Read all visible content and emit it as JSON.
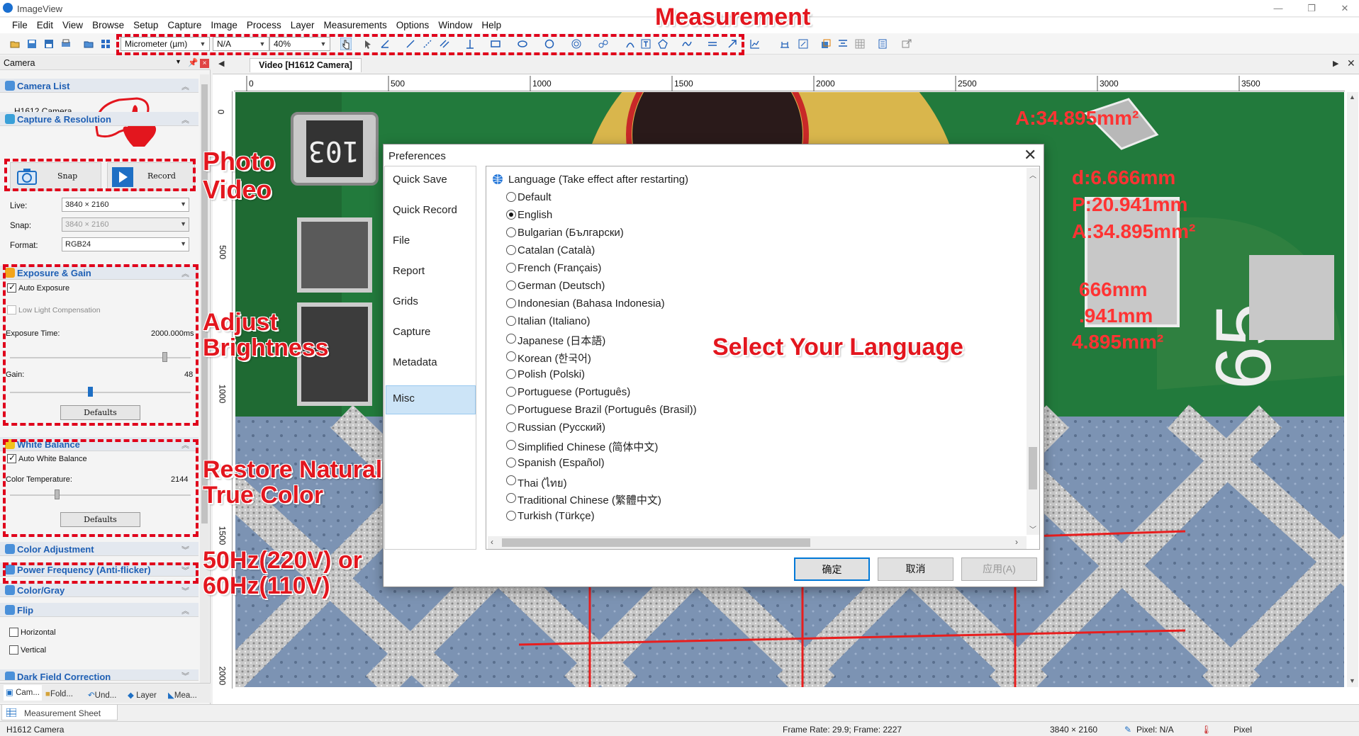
{
  "window": {
    "title": "ImageView"
  },
  "menu": [
    "File",
    "Edit",
    "View",
    "Browse",
    "Setup",
    "Capture",
    "Image",
    "Process",
    "Layer",
    "Measurements",
    "Options",
    "Window",
    "Help"
  ],
  "toolbar": {
    "unit": "Micrometer (µm)",
    "calibration": "N/A",
    "zoom": "40%"
  },
  "panel": {
    "title": "Camera",
    "camera_list": {
      "title": "Camera List",
      "item": "H1612 Camera"
    },
    "capture": {
      "title": "Capture & Resolution",
      "snap_label": "Snap",
      "record_label": "Record",
      "live_label": "Live:",
      "live_value": "3840 × 2160",
      "snap_res_label": "Snap:",
      "snap_res_value": "3840 × 2160",
      "format_label": "Format:",
      "format_value": "RGB24"
    },
    "exposure": {
      "title": "Exposure & Gain",
      "auto_label": "Auto Exposure",
      "low_light_label": "Low Light Compensation",
      "time_label": "Exposure Time:",
      "time_value": "2000.000ms",
      "gain_label": "Gain:",
      "gain_value": "48",
      "defaults_label": "Defaults"
    },
    "white_balance": {
      "title": "White Balance",
      "auto_label": "Auto White Balance",
      "temp_label": "Color Temperature:",
      "temp_value": "2144",
      "defaults_label": "Defaults"
    },
    "color_adjustment": "Color Adjustment",
    "power_frequency": "Power Frequency (Anti-flicker)",
    "color_gray": "Color/Gray",
    "flip": {
      "title": "Flip",
      "horizontal": "Horizontal",
      "vertical": "Vertical"
    },
    "dark_field": "Dark Field Correction"
  },
  "bottom_tabs": [
    "Cam...",
    "Fold...",
    "Und...",
    "Layer",
    "Mea..."
  ],
  "measurement_sheet": "Measurement Sheet",
  "doc": {
    "tab": "Video [H1612 Camera]"
  },
  "ruler": {
    "h": [
      "0",
      "500",
      "1000",
      "1500",
      "2000",
      "2500",
      "3000",
      "3500"
    ],
    "v": [
      "0",
      "500",
      "1000",
      "1500",
      "2000"
    ]
  },
  "overlay_measures": {
    "a1": "A:34.895mm²",
    "d": "d:6.666mm",
    "p": "P:20.941mm",
    "a2": "A:34.895mm²",
    "b1": "666mm",
    "b2": ".941mm",
    "b3": "4.895mm²"
  },
  "pcb_marks": {
    "r1": "103",
    "r2": "65"
  },
  "annotations": {
    "measurement": "Measurement",
    "photo": "Photo",
    "video": "Video",
    "adjust": "Adjust",
    "brightness": "Brightness",
    "restore1": "Restore Natural",
    "restore2": "True Color",
    "freq1": "50Hz(220V) or",
    "freq2": "60Hz(110V)",
    "language": "Select Your Language"
  },
  "dialog": {
    "title": "Preferences",
    "nav": [
      "Quick Save",
      "Quick Record",
      "File",
      "Report",
      "Grids",
      "Capture",
      "Metadata",
      "Misc"
    ],
    "selected_nav": "Misc",
    "group_title": "Language (Take effect after restarting)",
    "languages": [
      "Default",
      "English",
      "Bulgarian (Български)",
      "Catalan (Català)",
      "French (Français)",
      "German (Deutsch)",
      "Indonesian (Bahasa Indonesia)",
      "Italian (Italiano)",
      "Japanese (日本語)",
      "Korean (한국어)",
      "Polish (Polski)",
      "Portuguese (Português)",
      "Portuguese Brazil (Português (Brasil))",
      "Russian (Русский)",
      "Simplified Chinese (简体中文)",
      "Spanish (Español)",
      "Thai (ไทย)",
      "Traditional Chinese (繁體中文)",
      "Turkish (Türkçe)"
    ],
    "selected_language": "English",
    "ok": "确定",
    "cancel": "取消",
    "apply": "应用(A)"
  },
  "status": {
    "camera": "H1612 Camera",
    "frame": "Frame Rate: 29.9; Frame: 2227",
    "resolution": "3840 × 2160",
    "pixel": "Pixel: N/A",
    "unit": "Pixel"
  }
}
